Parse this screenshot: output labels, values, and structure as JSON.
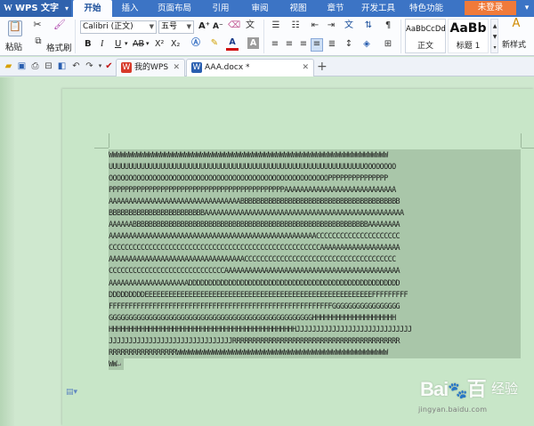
{
  "app": {
    "name": "WPS 文字",
    "logo_letter": "W"
  },
  "menu": {
    "tabs": [
      {
        "label": "开始",
        "active": true
      },
      {
        "label": "插入"
      },
      {
        "label": "页面布局"
      },
      {
        "label": "引用"
      },
      {
        "label": "审阅"
      },
      {
        "label": "视图"
      },
      {
        "label": "章节"
      },
      {
        "label": "开发工具"
      },
      {
        "label": "特色功能"
      }
    ],
    "login_label": "未登录"
  },
  "ribbon": {
    "paste_label": "粘贴",
    "format_painter_label": "格式刷",
    "font_name": "Calibri (正文)",
    "font_size": "五号",
    "bold": "B",
    "italic": "I",
    "underline": "U",
    "strike": "AB",
    "superscript": "X²",
    "subscript": "X₂",
    "grow_font": "A⁺",
    "shrink_font": "A⁻",
    "font_color": "A",
    "char_shade": "A",
    "styles": [
      {
        "sample": "AaBbCcDd",
        "name": "正文"
      },
      {
        "sample": "AaBb",
        "name": "标题 1"
      }
    ],
    "new_style_label": "新样式"
  },
  "doc_tabs": [
    {
      "label": "我的WPS",
      "active": false
    },
    {
      "label": "AAA.docx *",
      "active": true
    }
  ],
  "document": {
    "lines": [
      "WWWWWWWWWWWWWWWWWWWWWWWWWWWWWWWWWWWWWWWWWWWWWWWWWWWWWWWWWWWWWWWWWWWWWW",
      "UUUUUUUUUUUUUUUUUUUUUUUUUUUUUUUUUUUUUUUUUUUUUUUUUUUUUUUUUUUUUUUUOOOOOOOO",
      "OOOOOOOOOOOOOOOOOOOOOOOOOOOOOOOOOOOOOOOOOOOOOOOOOOOOOOOPPPPPPPPPPPPPPP",
      "PPPPPPPPPPPPPPPPPPPPPPPPPPPPPPPPPPPPPPPPPPPPAAAAAAAAAAAAAAAAAAAAAAAAAAAA",
      "AAAAAAAAAAAAAAAAAAAAAAAAAAAAAAAAABBBBBBBBBBBBBBBBBBBBBBBBBBBBBBBBBBBBBBBB",
      "BBBBBBBBBBBBBBBBBBBBBBBBAAAAAAAAAAAAAAAAAAAAAAAAAAAAAAAAAAAAAAAAAAAAAAAAAA",
      "AAAAAABBBBBBBBBBBBBBBBBBBBBBBBBBBBBBBBBBBBBBBBBBBBBBBBBBBBBBBBBBBAAAAAAAA",
      "AAAAAAAAAAAAAAAAAAAAAAAAAAAAAAAAAAAAAAAAAAAAAAAAAAAACCCCCCCCCCCCCCCCCCCCC",
      "CCCCCCCCCCCCCCCCCCCCCCCCCCCCCCCCCCCCCCCCCCCCCCCCCCCCCAAAAAAAAAAAAAAAAAAAA",
      "AAAAAAAAAAAAAAAAAAAAAAAAAAAAAAAAAACCCCCCCCCCCCCCCCCCCCCCCCCCCCCCCCCCCCCC",
      "CCCCCCCCCCCCCCCCCCCCCCCCCCCCCAAAAAAAAAAAAAAAAAAAAAAAAAAAAAAAAAAAAAAAAAAAA",
      "AAAAAAAAAAAAAAAAAAAADDDDDDDDDDDDDDDDDDDDDDDDDDDDDDDDDDDDDDDDDDDDDDDDDDDDD",
      "DDDDDDDDDEEEEEEEEEEEEEEEEEEEEEEEEEEEEEEEEEEEEEEEEEEEEEEEEEEEEEEEEEFFFFFFFFF",
      "FFFFFFFFFFFFFFFFFFFFFFFFFFFFFFFFFFFFFFFFFFFFFFFFFFFFFFFFGGGGGGGGGGGGGGGGG",
      "GGGGGGGGGGGGGGGGGGGGGGGGGGGGGGGGGGGGGGGGGGGGGGGGGGGHHHHHHHHHHHHHHHHHHHHH",
      "HHHHHHHHHHHHHHHHHHHHHHHHHHHHHHHHHHHHHHHHHHHHHHHJJJJJJJJJJJJJJJJJJJJJJJJJJJJJ",
      "JJJJJJJJJJJJJJJJJJJJJJJJJJJJJJJRRRRRRRRRRRRRRRRRRRRRRRRRRRRRRRRRRRRRRRRRR",
      "RRRRRRRRRRRRRRRRRWWWWWWWWWWWWWWWWWWWWWWWWWWWWWWWWWWWWWWWWWWWWWWWWWWWWW"
    ],
    "last_line": "WW"
  },
  "watermark": {
    "logo": "Bai",
    "logo_tail": "百",
    "subtitle": "经验",
    "url": "jingyan.baidu.com"
  }
}
